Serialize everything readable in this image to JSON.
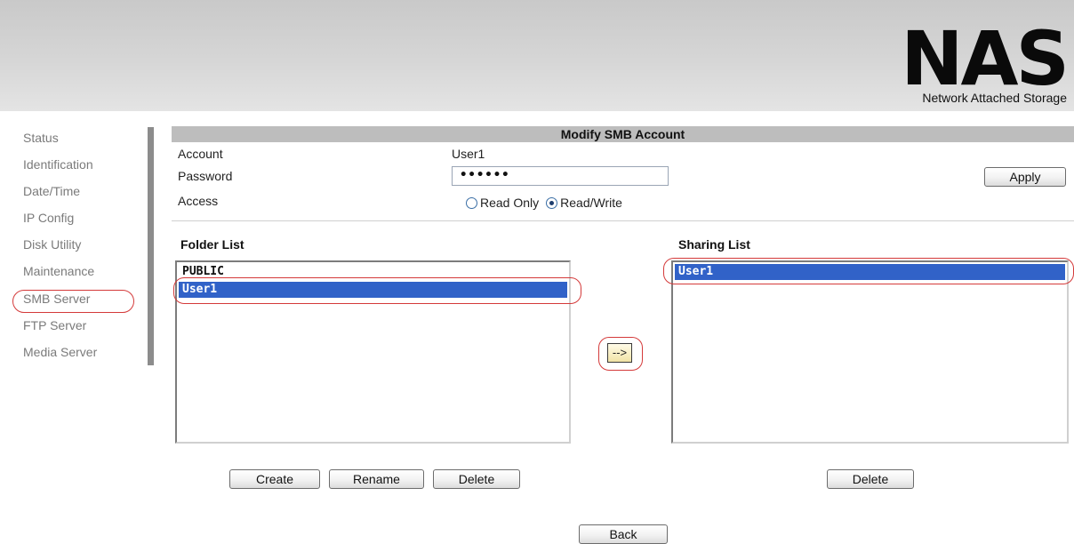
{
  "brand": {
    "logo": "NAS",
    "subtitle": "Network Attached Storage"
  },
  "sidebar": {
    "items": [
      {
        "label": "Status"
      },
      {
        "label": "Identification"
      },
      {
        "label": "Date/Time"
      },
      {
        "label": "IP Config"
      },
      {
        "label": "Disk Utility"
      },
      {
        "label": "Maintenance"
      },
      {
        "label": "SMB Server",
        "active": true
      },
      {
        "label": "FTP Server"
      },
      {
        "label": "Media Server"
      }
    ]
  },
  "form": {
    "title": "Modify SMB Account",
    "account_label": "Account",
    "account_value": "User1",
    "password_label": "Password",
    "password_value": "••••••",
    "access_label": "Access",
    "access_options": [
      "Read Only",
      "Read/Write"
    ],
    "access_selected": "Read/Write",
    "apply_label": "Apply"
  },
  "folder_list": {
    "heading": "Folder List",
    "items": [
      "PUBLIC",
      "User1"
    ],
    "selected": "User1",
    "buttons": {
      "create": "Create",
      "rename": "Rename",
      "delete": "Delete"
    }
  },
  "transfer_button": "-->",
  "sharing_list": {
    "heading": "Sharing List",
    "items": [
      "User1"
    ],
    "selected": "User1",
    "delete_label": "Delete"
  },
  "back_label": "Back",
  "colors": {
    "selection": "#3162c8",
    "annotation_ring": "#d43a3a",
    "title_bar": "#bdbdbd"
  }
}
